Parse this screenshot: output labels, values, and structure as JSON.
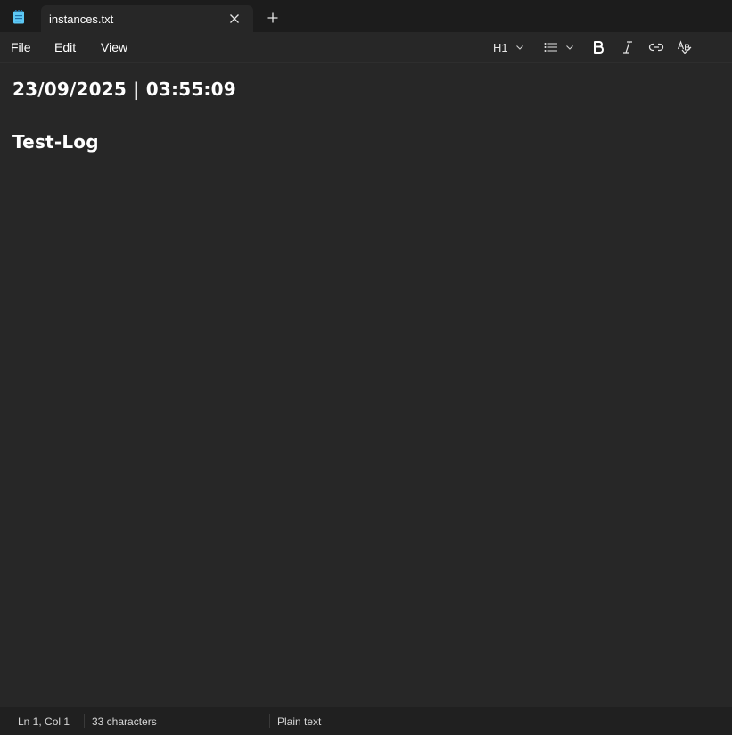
{
  "app": {
    "icon": "notepad-icon",
    "tab_title": "instances.txt",
    "close_icon": "close-icon",
    "new_tab_icon": "plus-icon"
  },
  "menu": {
    "file": "File",
    "edit": "Edit",
    "view": "View"
  },
  "toolbar": {
    "heading_label": "H1",
    "heading_icon": "chevron-down-icon",
    "list_icon": "bulleted-list-icon",
    "bold_icon": "bold-icon",
    "italic_icon": "italic-icon",
    "link_icon": "link-icon",
    "spellcheck_icon": "spellcheck-icon"
  },
  "document": {
    "lines": [
      "23/09/2025 | 03:55:09",
      "Test-Log"
    ]
  },
  "status": {
    "position": "Ln 1, Col 1",
    "char_count": "33 characters",
    "format": "Plain text"
  },
  "colors": {
    "background": "#272727",
    "tabbar": "#1c1c1c",
    "statusbar": "#202020",
    "icon_accent": "#4cc2ff"
  }
}
